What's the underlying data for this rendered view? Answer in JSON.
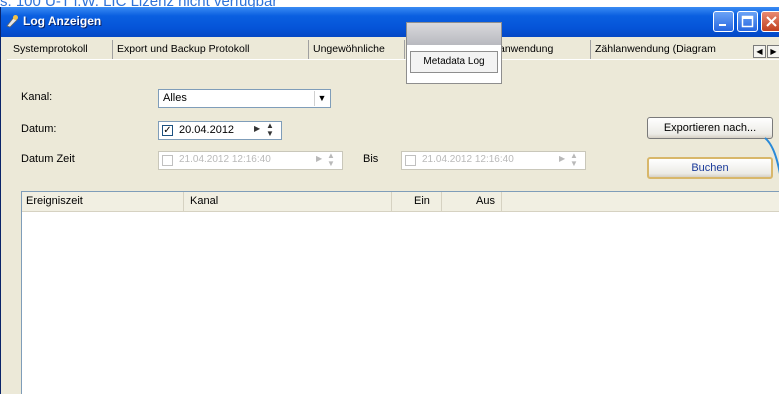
{
  "background": {
    "caption": "s. 100 U-T i.W. LIC Lizenz nicht verfügbar"
  },
  "window": {
    "title": "Log Anzeigen",
    "controls": [
      "minimize",
      "maximize",
      "close"
    ]
  },
  "tabs": [
    {
      "label": "Systemprotokoll"
    },
    {
      "label": "Export und Backup Protokoll"
    },
    {
      "label": "Ungewöhnliche"
    },
    {
      "label": "anwendung"
    },
    {
      "label": "Zählanwendung (Diagram"
    }
  ],
  "popup": {
    "label": "Metadata Log"
  },
  "form": {
    "kanal_label": "Kanal:",
    "kanal_value": "Alles",
    "datum_label": "Datum:",
    "datum_value": "20.04.2012",
    "datum_checked": true,
    "datumzeit_label": "Datum Zeit",
    "datumzeit_from": "21.04.2012 12:16:40",
    "bis_label": "Bis",
    "datumzeit_to": "21.04.2012 12:16:40",
    "export_label": "Exportieren nach...",
    "search_label": "Buchen"
  },
  "table": {
    "columns": [
      "Ereigniszeit",
      "Kanal",
      "Ein",
      "Aus"
    ],
    "rows": []
  },
  "colors": {
    "titlebar": "#0554d8",
    "window_bg": "#ece9d8",
    "caption": "#2f73d8"
  }
}
